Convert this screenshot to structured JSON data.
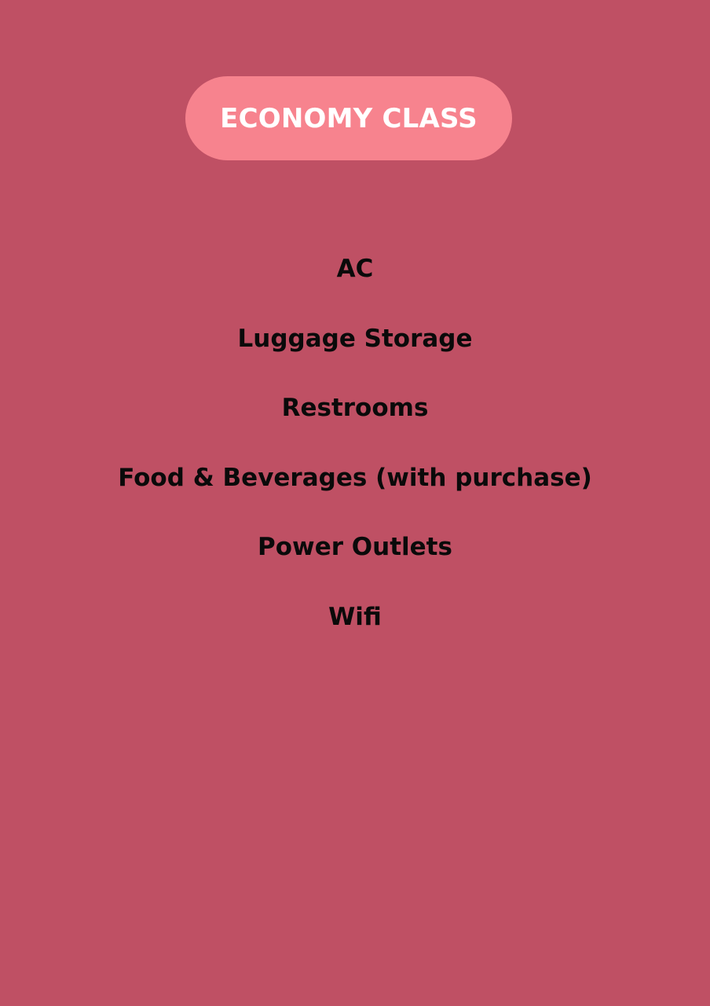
{
  "header": {
    "title": "ECONOMY CLASS"
  },
  "amenities": [
    "AC",
    "Luggage Storage",
    "Restrooms",
    "Food & Beverages (with purchase)",
    "Power Outlets",
    "Wifi"
  ],
  "colors": {
    "background": "#bf5064",
    "pill": "#f7838e",
    "title_text": "#ffffff",
    "body_text": "#0a0a0a"
  }
}
